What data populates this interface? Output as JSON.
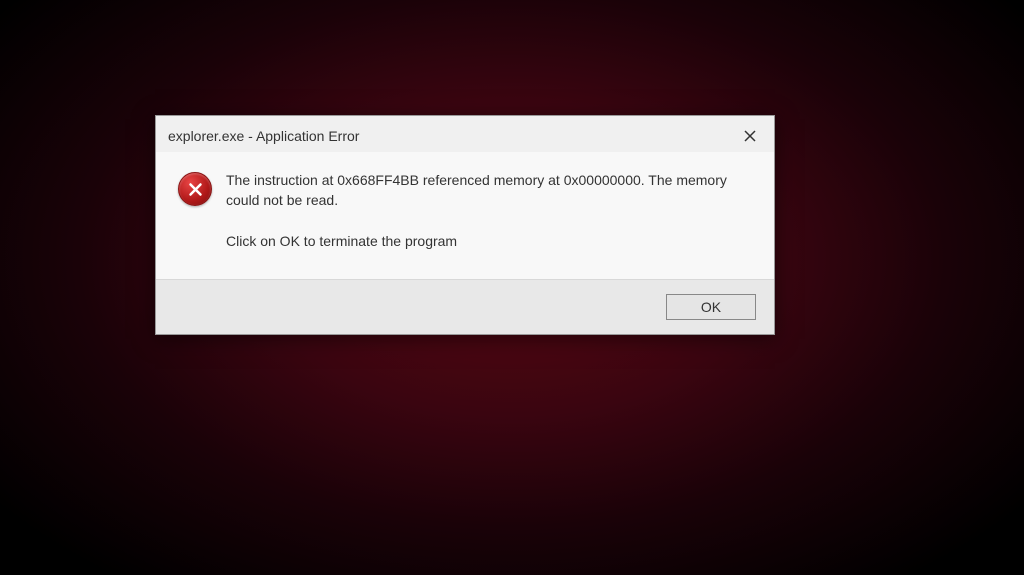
{
  "dialog": {
    "title": "explorer.exe - Application Error",
    "message_line1": "The instruction at 0x668FF4BB referenced memory at 0x00000000. The memory could not be read.",
    "message_line2": "Click on OK to terminate the program",
    "ok_label": "OK"
  }
}
